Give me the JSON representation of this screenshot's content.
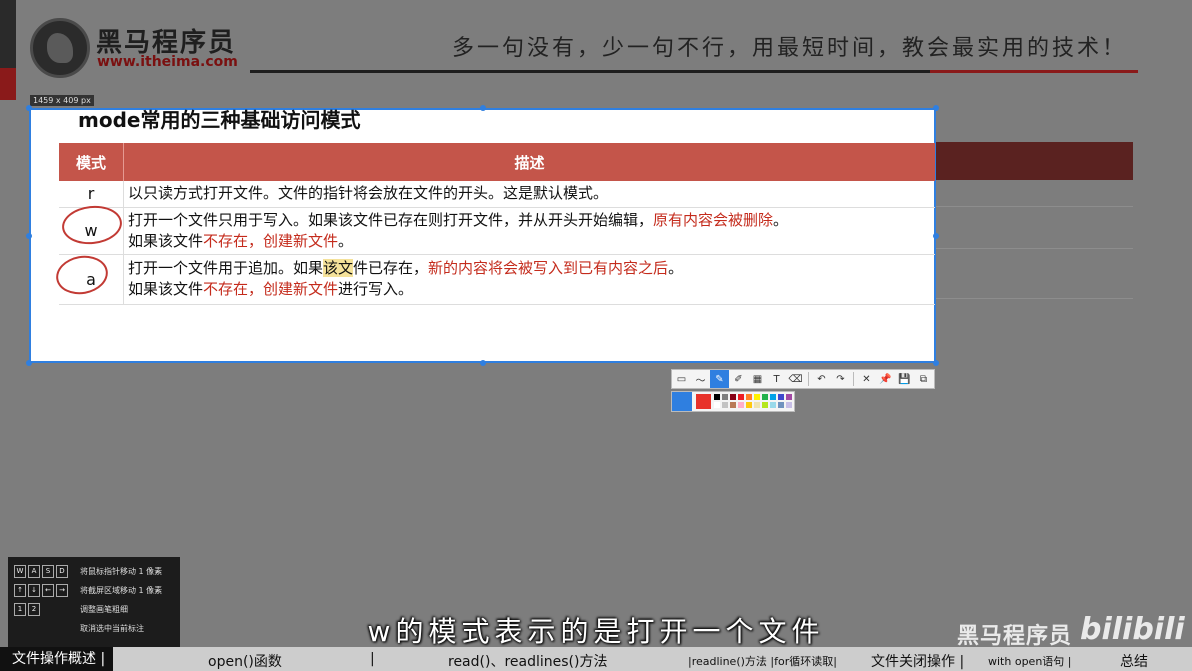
{
  "header": {
    "brand": "黑马程序员",
    "brand_url": "www.itheima.com",
    "slogan": "多一句没有，少一句不行，用最短时间，教会最实用的技术！"
  },
  "capture": {
    "size_label": "1459 x 409  px",
    "title": "mode常用的三种基础访问模式",
    "col_mode": "模式",
    "col_desc": "描述",
    "rows": [
      {
        "mode": "r",
        "line1": "以只读方式打开文件。文件的指针将会放在文件的开头。这是默认模式。"
      },
      {
        "mode": "w",
        "line1_a": "打开一个文件只用于写入。如果该文件已存在则打开文件，并从开头开始编辑，",
        "line1_b": "原有内容会被删除",
        "line1_c": "。",
        "line2_a": "如果该文件",
        "line2_b": "不存在，创建新文件",
        "line2_c": "。"
      },
      {
        "mode": "a",
        "line1_a": "打开一个文件用于追加。如果",
        "line1_hl": "该文",
        "line1_b": "件已存在，",
        "line1_c": "新的内容将会被写入到已有内容之后",
        "line1_d": "。",
        "line2_a": "如果该文件",
        "line2_b": "不存在，创建新文件",
        "line2_c": "进行写入。"
      }
    ]
  },
  "toolbar": {
    "icons": [
      "rect-icon",
      "polyline-icon",
      "pen-icon",
      "marker-icon",
      "mosaic-icon",
      "text-icon",
      "eraser-icon",
      "undo-icon",
      "redo-icon",
      "close-icon",
      "pin-icon",
      "save-icon",
      "copy-icon"
    ],
    "glyphs": [
      "▭",
      "〜",
      "✎",
      "✐",
      "▦",
      "T",
      "⌫",
      "↶",
      "↷",
      "✕",
      "📌",
      "💾",
      "⧉"
    ],
    "active_index": 2
  },
  "palette": {
    "current": "#e8322a",
    "swatches": [
      "#000000",
      "#7f7f7f",
      "#880015",
      "#ed1c24",
      "#ff7f27",
      "#fff200",
      "#22b14c",
      "#00a2e8",
      "#3f48cc",
      "#a349a4",
      "#ffffff",
      "#c3c3c3",
      "#b97a57",
      "#ffaec9",
      "#ffc90e",
      "#efe4b0",
      "#b5e61d",
      "#99d9ea",
      "#7092be",
      "#c8bfe7"
    ]
  },
  "shortcuts": [
    {
      "keys": [
        "W",
        "A",
        "S",
        "D"
      ],
      "text": "将鼠标指针移动 1 像素"
    },
    {
      "keys": [
        "↑",
        "↓",
        "←",
        "→"
      ],
      "text": "将截屏区域移动 1 像素"
    },
    {
      "keys": [
        "1",
        "2"
      ],
      "text": "调整画笔粗细"
    },
    {
      "keys": [],
      "text": "取消选中当前标注"
    }
  ],
  "subtitle": "w的模式表示的是打开一个文件",
  "watermark": {
    "brand": "黑马程序员",
    "site": "bilibili"
  },
  "bottom_nav": {
    "items": [
      "文件操作概述 |",
      "open()函数",
      "|",
      "read()、readlines()方法",
      "|readline()方法 |for循环读取|",
      "文件关闭操作 |",
      "with open语句 |",
      "总结"
    ]
  }
}
